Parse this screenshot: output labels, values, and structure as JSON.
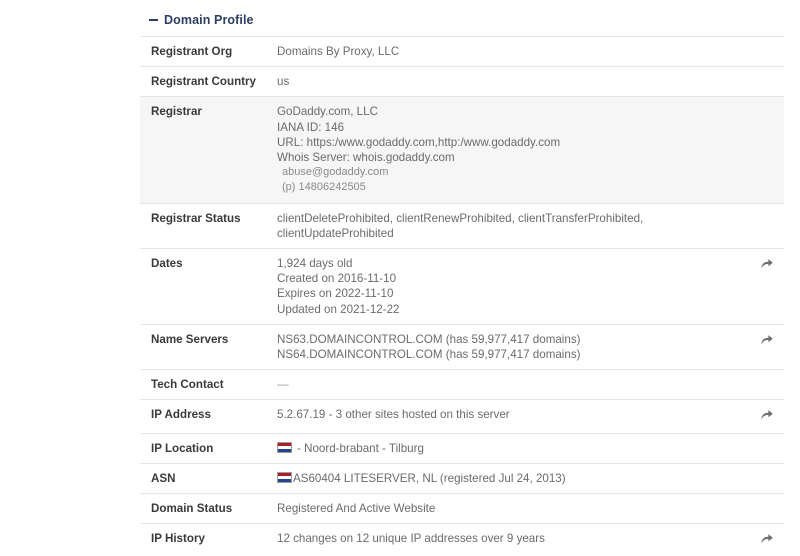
{
  "panel": {
    "title": "Domain Profile",
    "collapse_icon": "minus-icon"
  },
  "rows": [
    {
      "label": "Registrant Org",
      "lines": [
        "Domains By Proxy, LLC"
      ]
    },
    {
      "label": "Registrant Country",
      "lines": [
        "us"
      ]
    },
    {
      "label": "Registrar",
      "lines": [
        "GoDaddy.com, LLC",
        "IANA ID: 146",
        "URL: https:/www.godaddy.com,http:/www.godaddy.com",
        "Whois Server: whois.godaddy.com"
      ],
      "sub_lines": [
        "abuse@godaddy.com",
        "(p) 14806242505"
      ]
    },
    {
      "label": "Registrar Status",
      "lines": [
        "clientDeleteProhibited, clientRenewProhibited, clientTransferProhibited,",
        "clientUpdateProhibited"
      ]
    },
    {
      "label": "Dates",
      "lines": [
        "1,924 days old",
        "Created on 2016-11-10",
        "Expires on 2022-11-10",
        "Updated on 2021-12-22"
      ]
    },
    {
      "label": "Name Servers",
      "lines": [
        "NS63.DOMAINCONTROL.COM (has 59,977,417 domains)",
        "NS64.DOMAINCONTROL.COM (has 59,977,417 domains)"
      ]
    },
    {
      "label": "Tech Contact",
      "lines": [
        "—"
      ]
    },
    {
      "label": "IP Address",
      "lines": [
        "5.2.67.19 - 3 other sites hosted on this server"
      ]
    },
    {
      "label": "IP Location",
      "lines": [
        "- Noord-brabant - Tilburg"
      ]
    },
    {
      "label": "ASN",
      "lines": [
        "AS60404 LITESERVER, NL (registered Jul 24, 2013)"
      ]
    },
    {
      "label": "Domain Status",
      "lines": [
        "Registered And Active Website"
      ]
    },
    {
      "label": "IP History",
      "lines": [
        "12 changes on 12 unique IP addresses over 9 years"
      ]
    }
  ],
  "icons": {
    "share": "share-arrow-icon",
    "flag_nl": "netherlands-flag-icon"
  },
  "colors": {
    "header_text": "#2c3e63",
    "label_text": "#3a3a3a",
    "value_text": "#6b6b6b",
    "row_border": "#e6e6e6",
    "shaded_row": "#f6f6f6",
    "flag_red": "#ae1c28",
    "flag_blue": "#21468b"
  }
}
